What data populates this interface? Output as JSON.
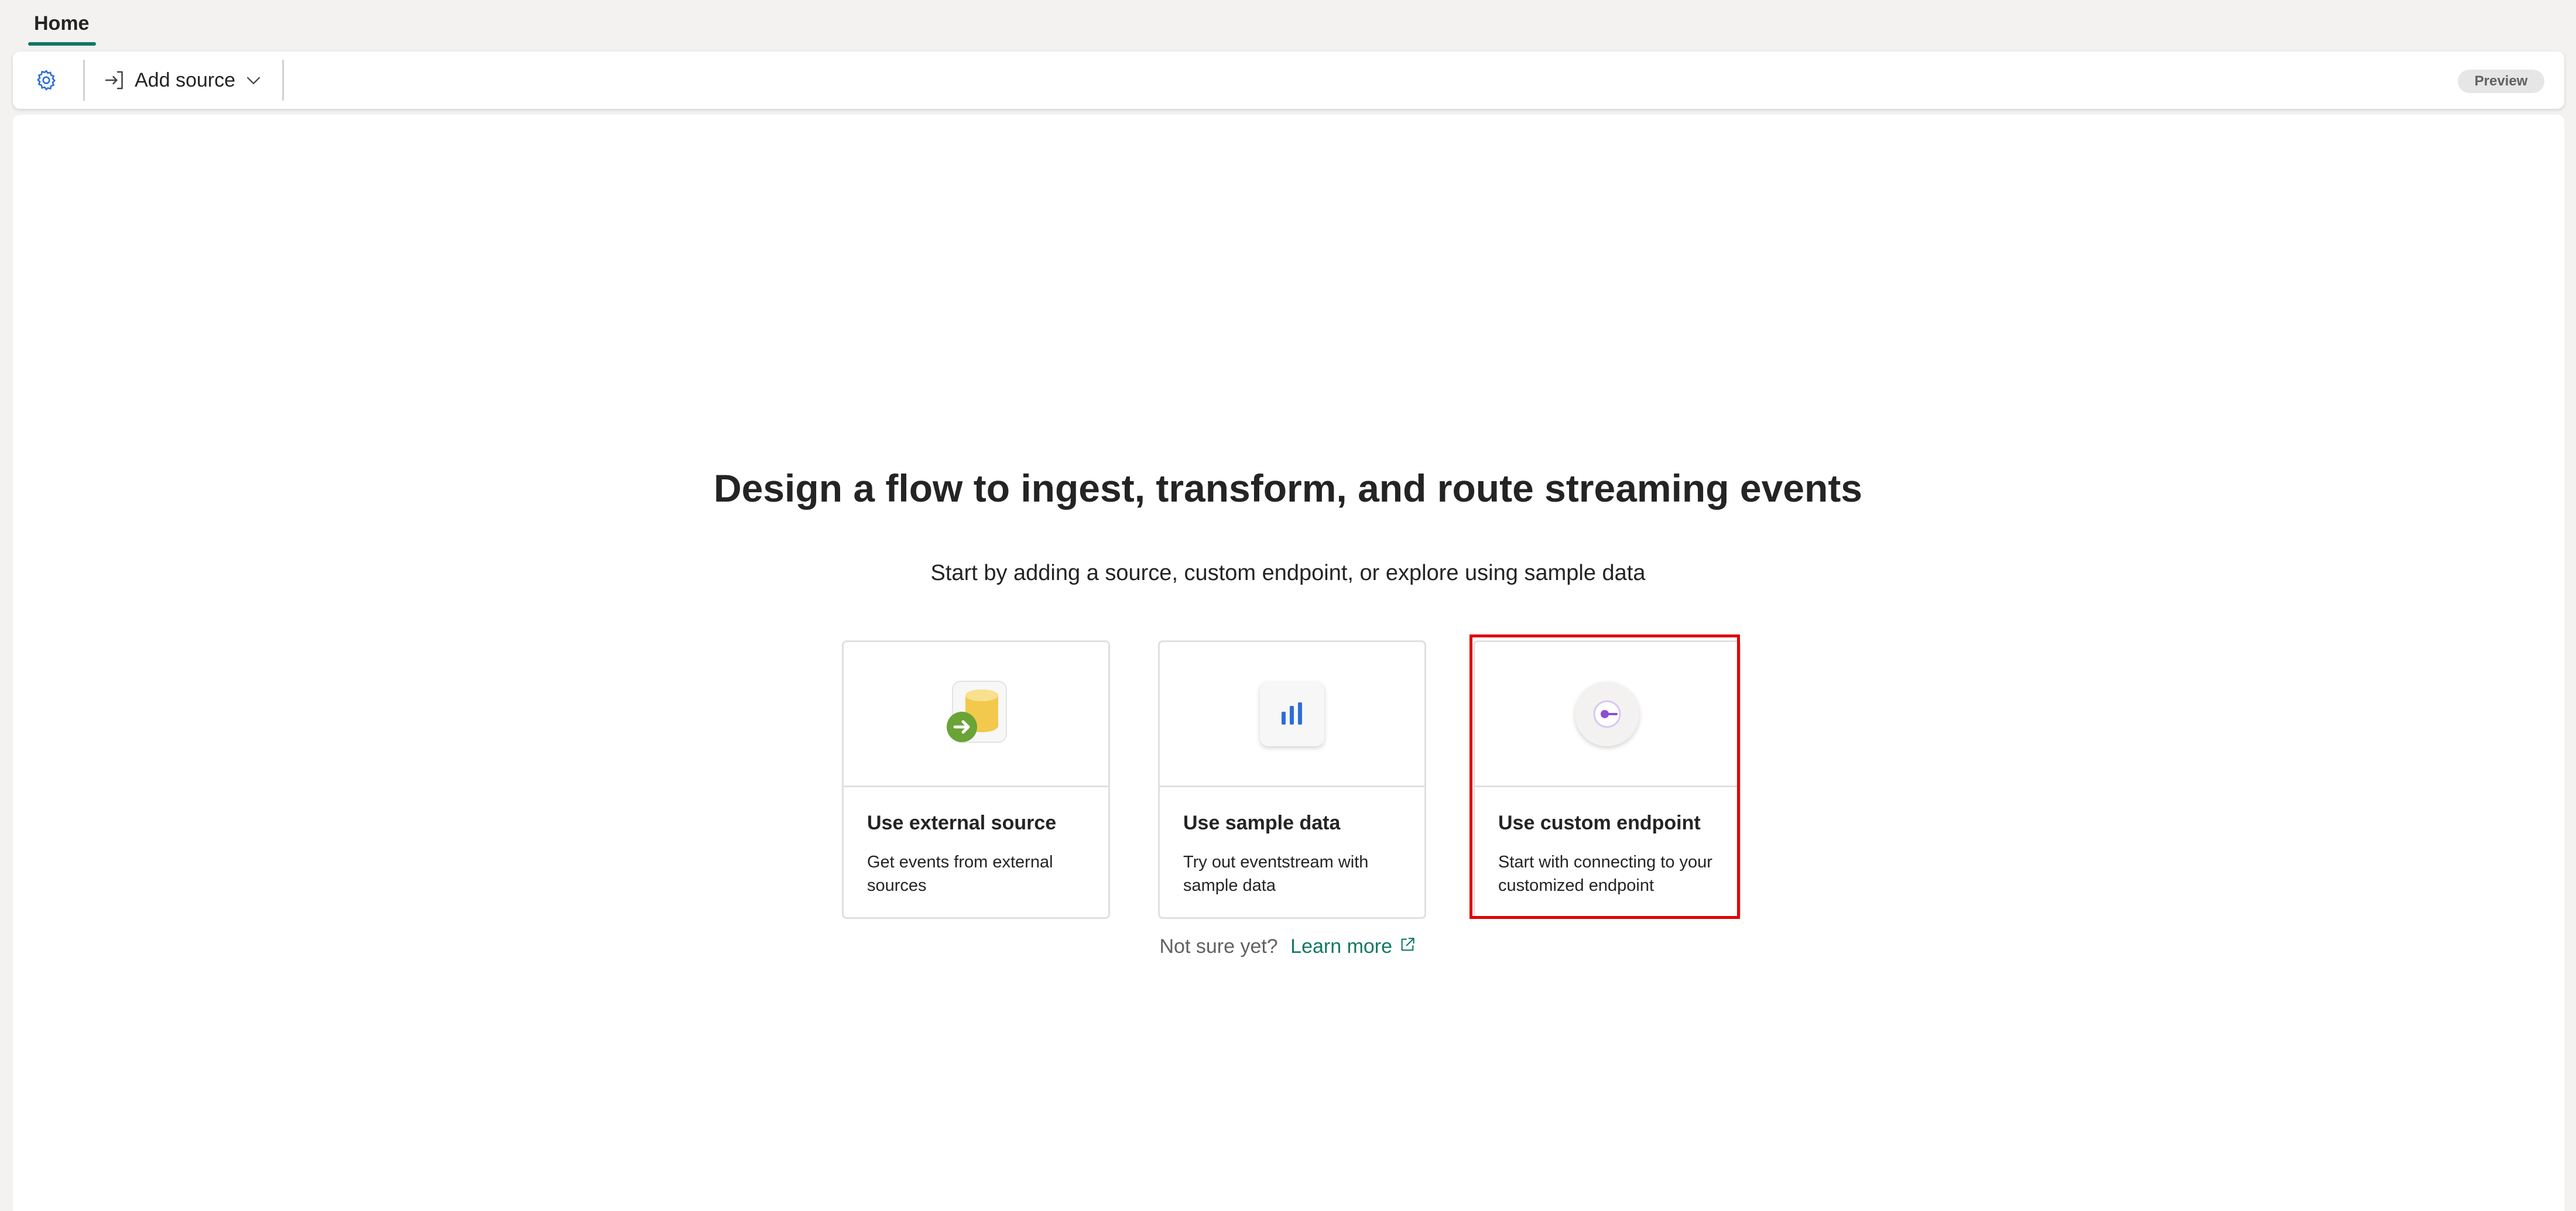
{
  "tabs": [
    {
      "label": "Home",
      "active": true
    }
  ],
  "toolbar": {
    "settings_icon": "gear-icon",
    "add_source_label": "Add source",
    "add_source_icon": "sign-in-arrow-icon",
    "dropdown_icon": "chevron-down-icon",
    "preview_badge": "Preview"
  },
  "main": {
    "headline": "Design a flow to ingest, transform, and route streaming events",
    "subline": "Start by adding a source, custom endpoint, or explore using sample data",
    "cards": [
      {
        "title": "Use external source",
        "description": "Get events from external sources",
        "icon": "database-arrow-icon"
      },
      {
        "title": "Use sample data",
        "description": "Try out eventstream with sample data",
        "icon": "bar-chart-icon"
      },
      {
        "title": "Use custom endpoint",
        "description": "Start with connecting to your customized endpoint",
        "icon": "endpoint-icon",
        "highlighted": true
      }
    ],
    "footer": {
      "prefix": "Not sure yet?",
      "link": "Learn more",
      "link_icon": "external-link-icon"
    }
  },
  "colors": {
    "accent": "#117865",
    "highlight": "#e00000",
    "endpoint_purple": "#8a4fd6",
    "chart_blue": "#2e6fd6",
    "db_yellow": "#f2c94c",
    "arrow_green": "#6aa336"
  }
}
